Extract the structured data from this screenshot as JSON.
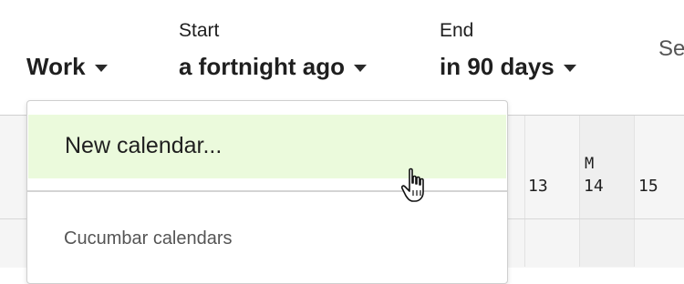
{
  "filters": {
    "calendar": {
      "value": "Work"
    },
    "start": {
      "label": "Start",
      "value": "a fortnight ago"
    },
    "end": {
      "label": "End",
      "value": "in 90 days"
    },
    "truncated_next": "Se"
  },
  "grid": {
    "days": [
      {
        "number": "13",
        "weekday": ""
      },
      {
        "number": "14",
        "weekday": "M"
      },
      {
        "number": "15",
        "weekday": ""
      }
    ]
  },
  "dropdown": {
    "items": [
      {
        "label": "New calendar..."
      }
    ],
    "section_heading": "Cucumbar calendars"
  },
  "colors": {
    "highlight": "#ebfadc",
    "text": "#1f1f1f",
    "muted": "#555555"
  },
  "icons": {
    "caret": "caret-down-icon",
    "cursor": "hand-pointer-icon"
  }
}
